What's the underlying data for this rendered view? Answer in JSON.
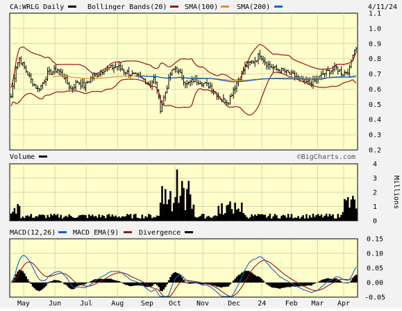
{
  "header": {
    "symbol_label": "CA:WRLG Daily",
    "legend": [
      {
        "label": "Bollinger Bands(20)",
        "color": "#000000"
      },
      {
        "label": "SMA(100)",
        "color": "#a01010"
      },
      {
        "label": "SMA(200)",
        "color": "#e09020"
      }
    ],
    "extra_swatch_color": "#1060d0",
    "date": "4/11/24"
  },
  "watermark": "©BigCharts.com",
  "colors": {
    "panel_bg": "#ffffcc",
    "price_bar": "#000000",
    "bollinger": "#a01010",
    "sma100": "#1060d0",
    "sma200": "#e09020",
    "volume": "#000000",
    "macd": "#1060d0",
    "macd_ema": "#a01010",
    "divergence": "#000000"
  },
  "chart_data": [
    {
      "type": "ohlc",
      "panel": "price",
      "ylim": [
        0.2,
        1.1
      ],
      "yticks": [
        "1.1",
        "1.0",
        "0.9",
        "0.8",
        "0.7",
        "0.6",
        "0.5",
        "0.4",
        "0.3",
        "0.2"
      ],
      "xticks": [
        "May",
        "Jun",
        "Jul",
        "Aug",
        "Sep",
        "Oct",
        "Nov",
        "Dec",
        "24",
        "Feb",
        "Mar",
        "Apr"
      ],
      "close_keypoints": [
        [
          0,
          0.55
        ],
        [
          3,
          0.75
        ],
        [
          5,
          0.8
        ],
        [
          9,
          0.72
        ],
        [
          12,
          0.66
        ],
        [
          16,
          0.6
        ],
        [
          18,
          0.62
        ],
        [
          22,
          0.7
        ],
        [
          28,
          0.73
        ],
        [
          32,
          0.68
        ],
        [
          36,
          0.6
        ],
        [
          40,
          0.65
        ],
        [
          44,
          0.62
        ],
        [
          48,
          0.67
        ],
        [
          52,
          0.7
        ],
        [
          56,
          0.73
        ],
        [
          60,
          0.74
        ],
        [
          64,
          0.75
        ],
        [
          68,
          0.72
        ],
        [
          72,
          0.7
        ],
        [
          76,
          0.68
        ],
        [
          80,
          0.66
        ],
        [
          84,
          0.63
        ],
        [
          86,
          0.67
        ],
        [
          88,
          0.6
        ],
        [
          90,
          0.47
        ],
        [
          93,
          0.58
        ],
        [
          96,
          0.7
        ],
        [
          99,
          0.74
        ],
        [
          103,
          0.68
        ],
        [
          106,
          0.63
        ],
        [
          110,
          0.66
        ],
        [
          114,
          0.65
        ],
        [
          117,
          0.63
        ],
        [
          120,
          0.62
        ],
        [
          123,
          0.58
        ],
        [
          127,
          0.53
        ],
        [
          131,
          0.52
        ],
        [
          134,
          0.6
        ],
        [
          138,
          0.68
        ],
        [
          141,
          0.75
        ],
        [
          144,
          0.77
        ],
        [
          147,
          0.79
        ],
        [
          150,
          0.83
        ],
        [
          153,
          0.78
        ],
        [
          156,
          0.75
        ],
        [
          160,
          0.73
        ],
        [
          164,
          0.72
        ],
        [
          168,
          0.7
        ],
        [
          172,
          0.68
        ],
        [
          176,
          0.65
        ],
        [
          180,
          0.64
        ],
        [
          184,
          0.66
        ],
        [
          188,
          0.7
        ],
        [
          192,
          0.72
        ],
        [
          196,
          0.74
        ],
        [
          200,
          0.7
        ],
        [
          204,
          0.73
        ],
        [
          206,
          0.84
        ],
        [
          208,
          0.88
        ]
      ],
      "volume_ylim": [
        0,
        4
      ],
      "volume_yticks": [
        "4",
        "3",
        "2",
        "1",
        "0"
      ],
      "volume_unit": "Millions",
      "macd_ylim": [
        -0.05,
        0.15
      ],
      "macd_yticks": [
        "0.15",
        "0.10",
        "0.05",
        "0.00",
        "-0.05"
      ]
    }
  ],
  "volume_panel": {
    "title": "Volume"
  },
  "macd_panel": {
    "legend": [
      {
        "label": "MACD(12,26)",
        "color": "#1060d0"
      },
      {
        "label": "MACD EMA(9)",
        "color": "#a01010"
      },
      {
        "label": "Divergence",
        "color": "#000000"
      }
    ]
  }
}
